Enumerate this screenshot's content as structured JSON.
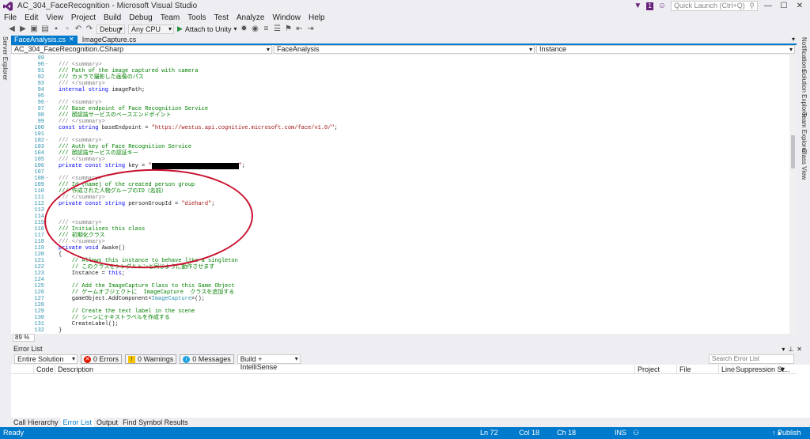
{
  "window": {
    "title": "AC_304_FaceRecognition - Microsoft Visual Studio",
    "notif_count": "1"
  },
  "quick_launch": {
    "placeholder": "Quick Launch (Ctrl+Q)"
  },
  "menu": [
    "File",
    "Edit",
    "View",
    "Project",
    "Build",
    "Debug",
    "Team",
    "Tools",
    "Test",
    "Analyze",
    "Window",
    "Help"
  ],
  "toolbar": {
    "config": "Debug",
    "platform": "Any CPU",
    "attach": "Attach to Unity"
  },
  "left_strip": {
    "label": "Server Explorer"
  },
  "right_strip": [
    "Notifications",
    "Solution Explorer",
    "Team Explorer",
    "Class View"
  ],
  "doc_tabs": [
    {
      "label": "FaceAnalysis.cs",
      "active": true
    },
    {
      "label": "ImageCapture.cs",
      "active": false
    }
  ],
  "nav": {
    "project": "AC_304_FaceRecognition.CSharp",
    "type": "FaceAnalysis",
    "member": "Instance"
  },
  "code_lines": [
    {
      "n": "89",
      "fold": "",
      "parts": []
    },
    {
      "n": "90",
      "fold": "−",
      "parts": [
        {
          "t": "/// <summary>",
          "c": "c-doc"
        }
      ]
    },
    {
      "n": "91",
      "fold": "",
      "parts": [
        {
          "t": "/// Path of the image captured with camera",
          "c": "c-comment"
        }
      ]
    },
    {
      "n": "92",
      "fold": "",
      "parts": [
        {
          "t": "/// カメラで撮影した画像のパス",
          "c": "c-comment"
        }
      ]
    },
    {
      "n": "93",
      "fold": "",
      "parts": [
        {
          "t": "/// </summary>",
          "c": "c-doc"
        }
      ]
    },
    {
      "n": "94",
      "fold": "",
      "parts": [
        {
          "t": "internal string ",
          "c": "c-kw"
        },
        {
          "t": "imagePath;",
          "c": ""
        }
      ]
    },
    {
      "n": "95",
      "fold": "",
      "parts": []
    },
    {
      "n": "96",
      "fold": "−",
      "parts": [
        {
          "t": "/// <summary>",
          "c": "c-doc"
        }
      ]
    },
    {
      "n": "97",
      "fold": "",
      "parts": [
        {
          "t": "/// Base endpoint of Face Recognition Service",
          "c": "c-comment"
        }
      ]
    },
    {
      "n": "98",
      "fold": "",
      "parts": [
        {
          "t": "/// 顔認識サービスのベースエンドポイント",
          "c": "c-comment"
        }
      ]
    },
    {
      "n": "99",
      "fold": "",
      "parts": [
        {
          "t": "/// </summary>",
          "c": "c-doc"
        }
      ]
    },
    {
      "n": "100",
      "fold": "",
      "parts": [
        {
          "t": "const string ",
          "c": "c-kw"
        },
        {
          "t": "baseEndpoint = ",
          "c": ""
        },
        {
          "t": "\"https://westus.api.cognitive.microsoft.com/face/v1.0/\"",
          "c": "c-str"
        },
        {
          "t": ";",
          "c": ""
        }
      ]
    },
    {
      "n": "101",
      "fold": "",
      "parts": []
    },
    {
      "n": "102",
      "fold": "−",
      "parts": [
        {
          "t": "/// <summary>",
          "c": "c-doc"
        }
      ]
    },
    {
      "n": "103",
      "fold": "",
      "parts": [
        {
          "t": "/// Auth key of Face Recognition Service",
          "c": "c-comment"
        }
      ]
    },
    {
      "n": "104",
      "fold": "",
      "parts": [
        {
          "t": "/// 顔認識サービスの認証キー",
          "c": "c-comment"
        }
      ]
    },
    {
      "n": "105",
      "fold": "",
      "parts": [
        {
          "t": "/// </summary>",
          "c": "c-doc"
        }
      ]
    },
    {
      "n": "106",
      "fold": "",
      "parts": [
        {
          "t": "private const string ",
          "c": "c-kw"
        },
        {
          "t": "key = ",
          "c": ""
        },
        {
          "t": "\"",
          "c": "c-str"
        },
        {
          "t": "",
          "c": "redact"
        },
        {
          "t": "\"",
          "c": "c-str"
        },
        {
          "t": ";",
          "c": ""
        }
      ]
    },
    {
      "n": "107",
      "fold": "",
      "parts": []
    },
    {
      "n": "108",
      "fold": "−",
      "parts": [
        {
          "t": "/// <summary>",
          "c": "c-doc"
        }
      ]
    },
    {
      "n": "109",
      "fold": "",
      "parts": [
        {
          "t": "/// Id (name) of the created person group",
          "c": "c-comment"
        }
      ]
    },
    {
      "n": "110",
      "fold": "",
      "parts": [
        {
          "t": "/// 作成された人物グループのID（名前）",
          "c": "c-comment"
        }
      ]
    },
    {
      "n": "111",
      "fold": "",
      "parts": [
        {
          "t": "/// </summary>",
          "c": "c-doc"
        }
      ]
    },
    {
      "n": "112",
      "fold": "",
      "parts": [
        {
          "t": "private const string ",
          "c": "c-kw"
        },
        {
          "t": "personGroupId = ",
          "c": ""
        },
        {
          "t": "\"diehard\"",
          "c": "c-str"
        },
        {
          "t": ";",
          "c": ""
        }
      ]
    },
    {
      "n": "113",
      "fold": "",
      "parts": []
    },
    {
      "n": "114",
      "fold": "",
      "parts": []
    },
    {
      "n": "115",
      "fold": "−",
      "parts": [
        {
          "t": "/// <summary>",
          "c": "c-doc"
        }
      ]
    },
    {
      "n": "116",
      "fold": "",
      "parts": [
        {
          "t": "/// Initialises this class",
          "c": "c-comment"
        }
      ]
    },
    {
      "n": "117",
      "fold": "",
      "parts": [
        {
          "t": "/// 初期化クラス",
          "c": "c-comment"
        }
      ]
    },
    {
      "n": "118",
      "fold": "",
      "parts": [
        {
          "t": "/// </summary>",
          "c": "c-doc"
        }
      ]
    },
    {
      "n": "119",
      "fold": "",
      "parts": [
        {
          "t": "private void ",
          "c": "c-kw"
        },
        {
          "t": "Awake()",
          "c": ""
        }
      ]
    },
    {
      "n": "120",
      "fold": "",
      "parts": [
        {
          "t": "{",
          "c": ""
        }
      ]
    },
    {
      "n": "121",
      "fold": "",
      "parts": [
        {
          "t": "    // Allows this instance to behave like a singleton",
          "c": "c-comment"
        }
      ]
    },
    {
      "n": "122",
      "fold": "",
      "parts": [
        {
          "t": "    // このクラスをシングルトンと同じように動作させます",
          "c": "c-comment"
        }
      ]
    },
    {
      "n": "123",
      "fold": "",
      "parts": [
        {
          "t": "    Instance = ",
          "c": ""
        },
        {
          "t": "this",
          "c": "c-kw"
        },
        {
          "t": ";",
          "c": ""
        }
      ]
    },
    {
      "n": "124",
      "fold": "",
      "parts": []
    },
    {
      "n": "125",
      "fold": "",
      "parts": [
        {
          "t": "    // Add the ImageCapture Class to this Game Object",
          "c": "c-comment"
        }
      ]
    },
    {
      "n": "126",
      "fold": "",
      "parts": [
        {
          "t": "    // ゲームオブジェクトに  ImageCapture  クラスを追加する",
          "c": "c-comment"
        }
      ]
    },
    {
      "n": "127",
      "fold": "",
      "parts": [
        {
          "t": "    gameObject.AddComponent<",
          "c": ""
        },
        {
          "t": "ImageCapture",
          "c": "c-type"
        },
        {
          "t": ">();",
          "c": ""
        }
      ]
    },
    {
      "n": "128",
      "fold": "",
      "parts": []
    },
    {
      "n": "129",
      "fold": "",
      "parts": [
        {
          "t": "    // Create the text label in the scene",
          "c": "c-comment"
        }
      ]
    },
    {
      "n": "130",
      "fold": "",
      "parts": [
        {
          "t": "    // シーンにテキストラベルを作成する",
          "c": "c-comment"
        }
      ]
    },
    {
      "n": "131",
      "fold": "",
      "parts": [
        {
          "t": "    CreateLabel();",
          "c": ""
        }
      ]
    },
    {
      "n": "132",
      "fold": "",
      "parts": [
        {
          "t": "}",
          "c": ""
        }
      ]
    }
  ],
  "zoom": "89 %",
  "error_list": {
    "title": "Error List",
    "scope": "Entire Solution",
    "errors": "0 Errors",
    "warnings": "0 Warnings",
    "messages": "0 Messages",
    "build_filter": "Build + IntelliSense",
    "search_placeholder": "Search Error List",
    "columns": [
      "Code",
      "Description",
      "Project",
      "File",
      "Line",
      "Suppression St..."
    ]
  },
  "bottom_tabs": [
    {
      "label": "Call Hierarchy",
      "active": false
    },
    {
      "label": "Error List",
      "active": true
    },
    {
      "label": "Output",
      "active": false
    },
    {
      "label": "Find Symbol Results",
      "active": false
    }
  ],
  "status": {
    "ready": "Ready",
    "ln": "Ln 72",
    "col": "Col 18",
    "ch": "Ch 18",
    "mode": "INS",
    "publish": "Publish"
  },
  "colors": {
    "accent": "#007acc",
    "annotation": "#c8102e"
  }
}
